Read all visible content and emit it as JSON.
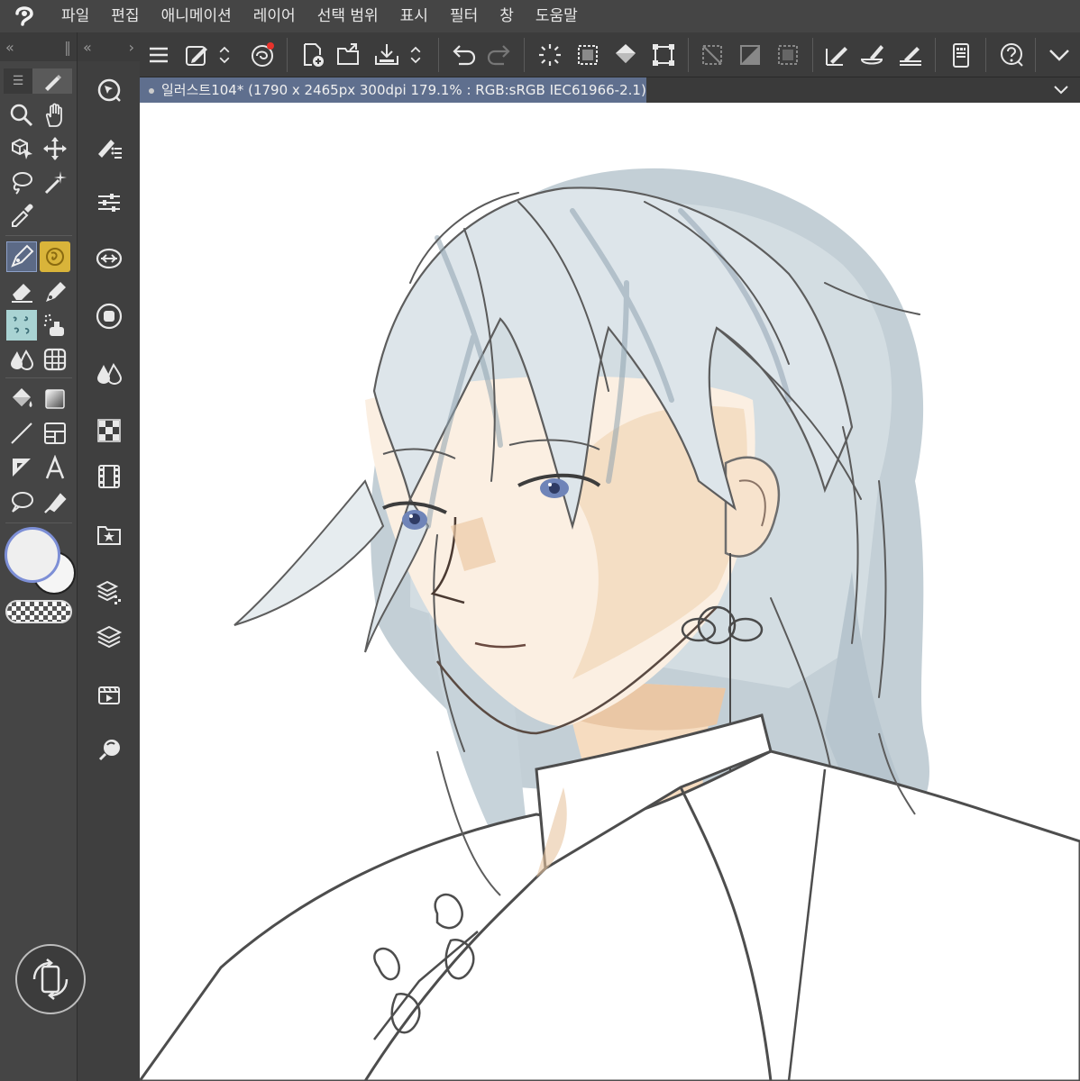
{
  "app": {
    "logo_icon": "clip-studio-logo-icon",
    "menu": [
      "파일",
      "편집",
      "애니메이션",
      "레이어",
      "선택 범위",
      "표시",
      "필터",
      "창",
      "도움말"
    ]
  },
  "tool_panel": {
    "collapse_left": "«",
    "collapse_right": "«",
    "expand": "›",
    "menu_tab": "☰",
    "tools": [
      "zoom-icon",
      "hand-icon",
      "object-select-icon",
      "move-icon",
      "lasso-select-icon",
      "magic-wand-icon",
      "eyedropper-icon",
      "pen-icon",
      "brush-icon",
      "eraser-icon",
      "decoration-pen-icon",
      "pattern-icon",
      "airbrush-icon",
      "blend-icon",
      "grid-fill-icon",
      "fill-bucket-icon",
      "gradient-icon",
      "line-icon",
      "frame-icon",
      "ruler-icon",
      "text-icon",
      "balloon-icon",
      "correction-icon"
    ],
    "main_color": "#efefef",
    "sub_color": "#f5f5f5",
    "active_tool": "pen-icon"
  },
  "side_panel": {
    "icons": [
      "navigator-icon",
      "sub-tool-icon",
      "tool-property-icon",
      "brush-size-icon",
      "color-wheel-icon",
      "color-set-icon",
      "approximate-color-icon",
      "intermediate-color-icon",
      "timeline-icon",
      "material-icon",
      "layer-property-icon",
      "layer-icon",
      "animation-cels-icon",
      "auto-action-icon"
    ],
    "rotate_icon": "canvas-rotate-icon"
  },
  "toolbar": {
    "icons": [
      "menu-icon",
      "edit-icon",
      "up-down-icon",
      "record-icon",
      "new-file-icon",
      "open-file-icon",
      "save-icon",
      "save-menu-icon",
      "undo-icon",
      "redo-icon",
      "clear-selection-icon",
      "select-all-icon",
      "fill-icon",
      "transform-icon",
      "hide-selection-icon",
      "clip-icon",
      "reference-layer-icon",
      "draft-layer-icon",
      "layer-brush-icon",
      "ruler-snap-icon",
      "device-icon",
      "help-icon",
      "more-icon"
    ]
  },
  "document": {
    "tab_title": "일러스트104* (1790 x 2465px 300dpi 179.1% : RGB:sRGB IEC61966-2.1)"
  }
}
